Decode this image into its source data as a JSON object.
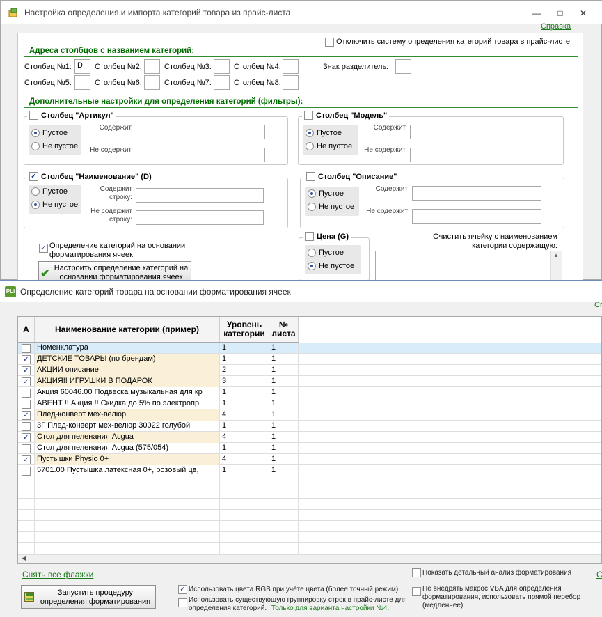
{
  "back_window": {
    "title": "Настройка определения и импорта категорий товара из прайс-листа",
    "help_link": "Справка",
    "disable_system": {
      "label": "Отключить систему определения категорий товара в прайс-листе",
      "checked": false
    },
    "columns_section_title": "Адреса столбцов с названием категорий:",
    "columns": [
      {
        "label": "Столбец №1:",
        "value": "D"
      },
      {
        "label": "Столбец №2:",
        "value": ""
      },
      {
        "label": "Столбец №3:",
        "value": ""
      },
      {
        "label": "Столбец №4:",
        "value": ""
      },
      {
        "label": "Столбец №5:",
        "value": ""
      },
      {
        "label": "Столбец №6:",
        "value": ""
      },
      {
        "label": "Столбец №7:",
        "value": ""
      },
      {
        "label": "Столбец №8:",
        "value": ""
      }
    ],
    "separator_label": "Знак разделитель:",
    "separator_value": "",
    "filters_section_title": "Дополнительные настройки для определения категорий (фильтры):",
    "filter_article": {
      "title": "Столбец \"Артикул\"",
      "checked": false,
      "empty": "Пустое",
      "not_empty": "Не пустое",
      "contains": "Содержит",
      "not_contains": "Не содержит"
    },
    "filter_model": {
      "title": "Столбец \"Модель\"",
      "checked": false,
      "empty": "Пустое",
      "not_empty": "Не пустое",
      "contains": "Содержит",
      "not_contains": "Не содержит"
    },
    "filter_name": {
      "title": "Столбец \"Наименование\" (D)",
      "checked": true,
      "empty": "Пустое",
      "not_empty": "Не пустое",
      "contains": "Содержит строку:",
      "not_contains": "Не содержит строку:"
    },
    "filter_desc": {
      "title": "Столбец \"Описание\"",
      "checked": false,
      "empty": "Пустое",
      "not_empty": "Не пустое",
      "contains": "Содержит",
      "not_contains": "Не содержит"
    },
    "filter_price": {
      "title": "Цена (G)",
      "checked": false,
      "empty": "Пустое",
      "not_empty": "Не пустое"
    },
    "format_based": {
      "label": "Определение категорий на основании форматирования ячеек",
      "checked": true
    },
    "configure_button": "Настроить определение категорий на основании форматирования ячеек",
    "clear_cell_label": "Очистить ячейку с наименованием категории содержащую:"
  },
  "front_window": {
    "logo_text": "PLi",
    "title": "Определение категорий товара на основании форматирования ячеек",
    "help_link_fragment": "Сп",
    "grid": {
      "headers": [
        "А",
        "Наименование категории (пример)",
        "Уровень категории",
        "№ листа"
      ],
      "rows": [
        {
          "checked": false,
          "name": "Номенклатура",
          "level": "1",
          "sheet": "1",
          "hl": false,
          "selected": true
        },
        {
          "checked": true,
          "name": "ДЕТСКИЕ ТОВАРЫ  (по брендам)",
          "level": "1",
          "sheet": "1",
          "hl": true,
          "selected": false
        },
        {
          "checked": true,
          "name": "      АКЦИИ описание",
          "level": "2",
          "sheet": "1",
          "hl": true,
          "selected": false
        },
        {
          "checked": true,
          "name": "         АКЦИЯ!! ИГРУШКИ В ПОДАРОК",
          "level": "3",
          "sheet": "1",
          "hl": true,
          "selected": false
        },
        {
          "checked": false,
          "name": "Акция 60046.00 Подвеска музыкальная для кр",
          "level": "1",
          "sheet": "1",
          "hl": false,
          "selected": false
        },
        {
          "checked": false,
          "name": " АВЕНТ !! Акция !! Скидка до 5% по электропр",
          "level": "1",
          "sheet": "1",
          "hl": false,
          "selected": false
        },
        {
          "checked": true,
          "name": "Плед-конверт мех-велюр",
          "level": "4",
          "sheet": "1",
          "hl": true,
          "selected": false
        },
        {
          "checked": false,
          "name": "3Г Плед-конверт мех-велюр 30022 голубой",
          "level": "1",
          "sheet": "1",
          "hl": false,
          "selected": false
        },
        {
          "checked": true,
          "name": "Стол для пеленания Acgua",
          "level": "4",
          "sheet": "1",
          "hl": true,
          "selected": false
        },
        {
          "checked": false,
          "name": "Стол для пеленания Acgua (575/054)",
          "level": "1",
          "sheet": "1",
          "hl": false,
          "selected": false
        },
        {
          "checked": true,
          "name": "Пустышки Physio  0+",
          "level": "4",
          "sheet": "1",
          "hl": true,
          "selected": false
        },
        {
          "checked": false,
          "name": "5701.00 Пустышка латексная 0+, розовый цв,",
          "level": "1",
          "sheet": "1",
          "hl": false,
          "selected": false
        }
      ]
    },
    "clear_flags_link": "Снять все флажки",
    "run_button": "Запустить процедуру определения форматирования",
    "use_rgb": {
      "label": "Использовать цвета RGB при учёте цвета (более точный режим).",
      "checked": true
    },
    "use_grouping": {
      "label": "Использовать существующую группировку строк в прайс-листе для определения категорий.",
      "checked": false
    },
    "variant_link": "Только для варианта настройки №4.",
    "show_analysis": {
      "label": "Показать детальный анализ форматирования",
      "checked": false
    },
    "no_vba": {
      "label": "Не внедрять макрос VBA для определения форматирования, использовать прямой перебор (медленнее)",
      "checked": false
    },
    "right_link_fragment": "С"
  }
}
